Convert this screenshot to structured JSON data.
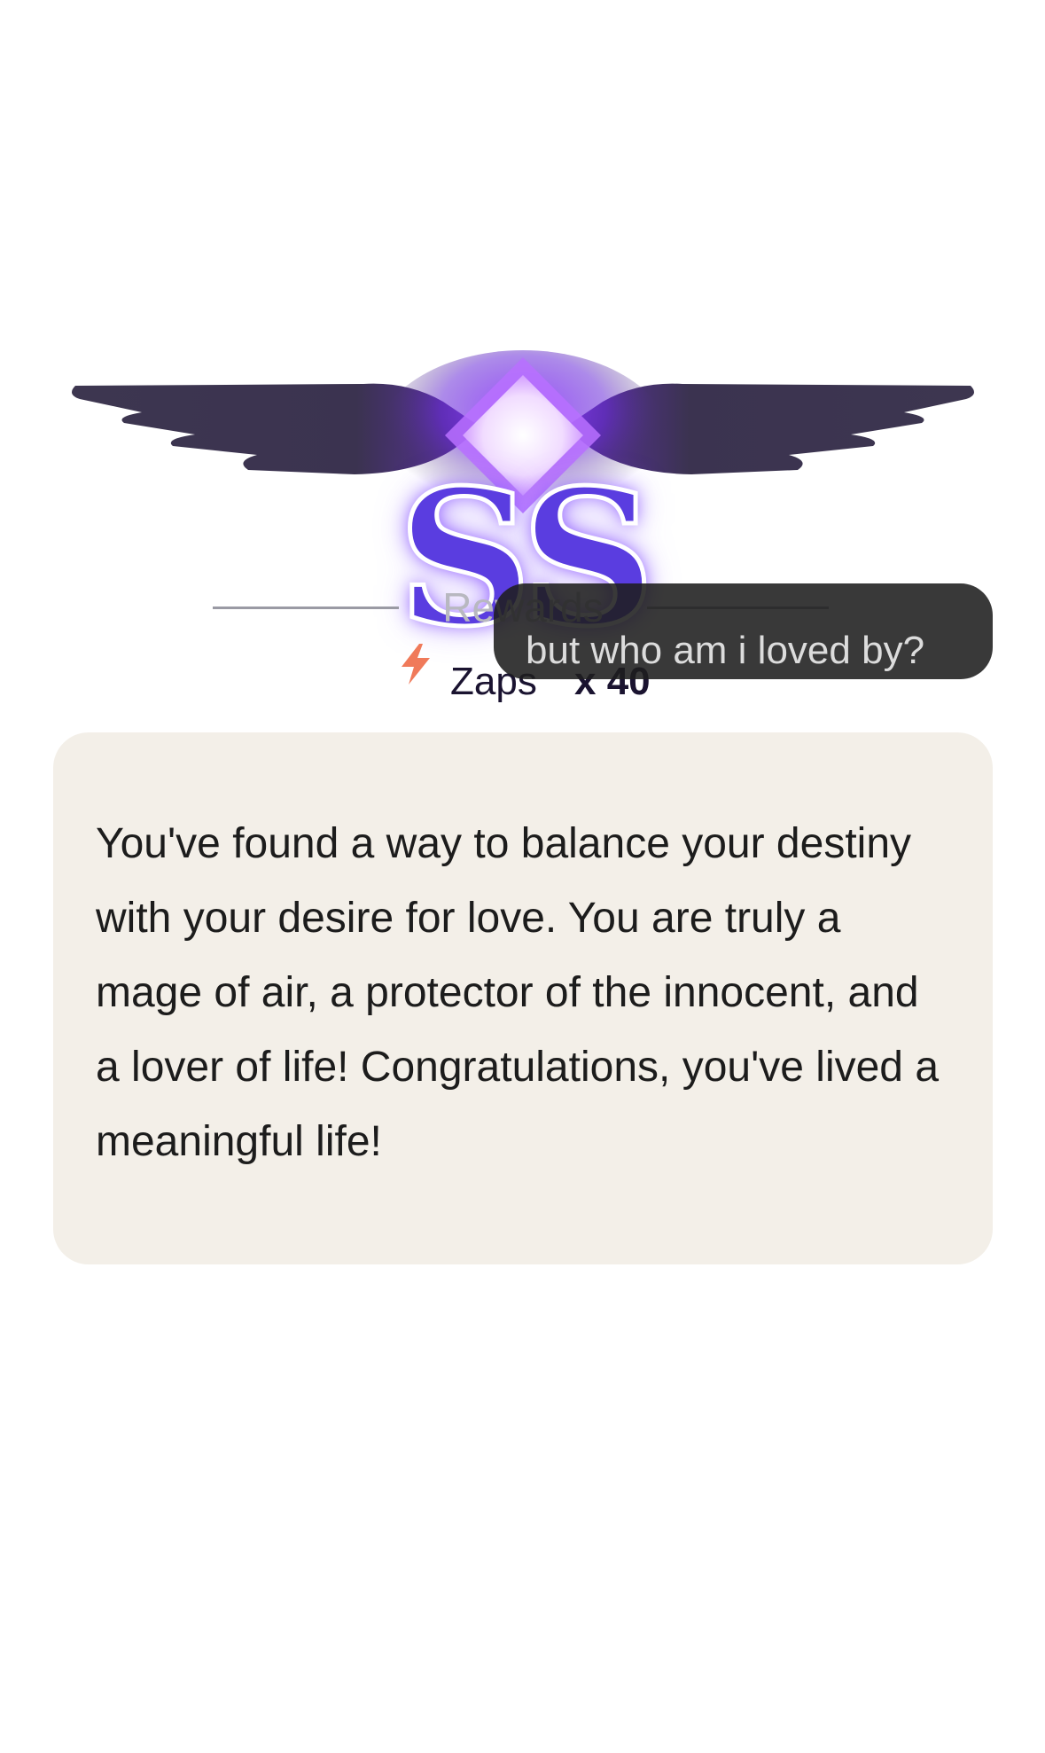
{
  "emblem": {
    "grade": "SS",
    "icon": "winged-diamond-emblem",
    "colors": {
      "wing": "#3b3548",
      "glow": "#7a3cff",
      "grade_fill": "#5a3de0",
      "gem": "#f4e6ff"
    }
  },
  "rewards": {
    "label": "Rewards",
    "items": [
      {
        "icon": "zap-icon",
        "name": "Zaps",
        "count": "x 40"
      }
    ]
  },
  "tooltip": {
    "text": "but who am i loved by?"
  },
  "message": {
    "text": "You've found a way to balance your destiny with your desire for love. You are truly a mage of air, a protector of the innocent, and a lover of life! Congratulations, you've lived a meaningful life!"
  },
  "colors": {
    "card_bg": "#f3efe8",
    "tooltip_bg": "#1e1e1e",
    "zap": "#f07a5a"
  }
}
